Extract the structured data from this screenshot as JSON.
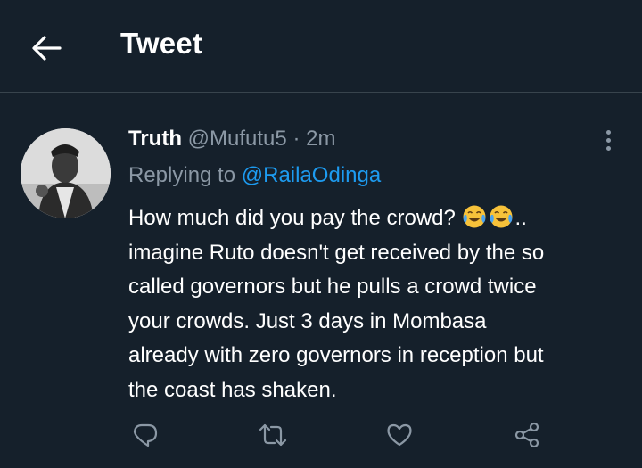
{
  "header": {
    "title": "Tweet",
    "back_icon": "arrow-left-icon"
  },
  "tweet": {
    "author_name": "Truth",
    "handle": "@Mufutu5",
    "separator": "·",
    "time": "2m",
    "reply_prefix": "Replying to",
    "reply_mention": "@RailaOdinga",
    "text_lines": [
      "How much did you pay the crowd?",
      "imagine Ruto doesn't get received by the so",
      "called governors but he pulls a crowd twice",
      "your crowds. Just 3 days in Mombasa",
      "already with zero governors in reception but",
      "the coast has shaken."
    ],
    "line1_suffix": "..",
    "emoji": [
      "face-with-tears-of-joy-icon",
      "face-with-tears-of-joy-icon"
    ]
  },
  "actions": {
    "icons": [
      "reply-icon",
      "retweet-icon",
      "like-icon",
      "share-icon"
    ]
  },
  "colors": {
    "background": "#15202b",
    "text": "#ffffff",
    "muted": "#8b98a5",
    "accent": "#1d9bf0",
    "divider": "#38444d"
  }
}
